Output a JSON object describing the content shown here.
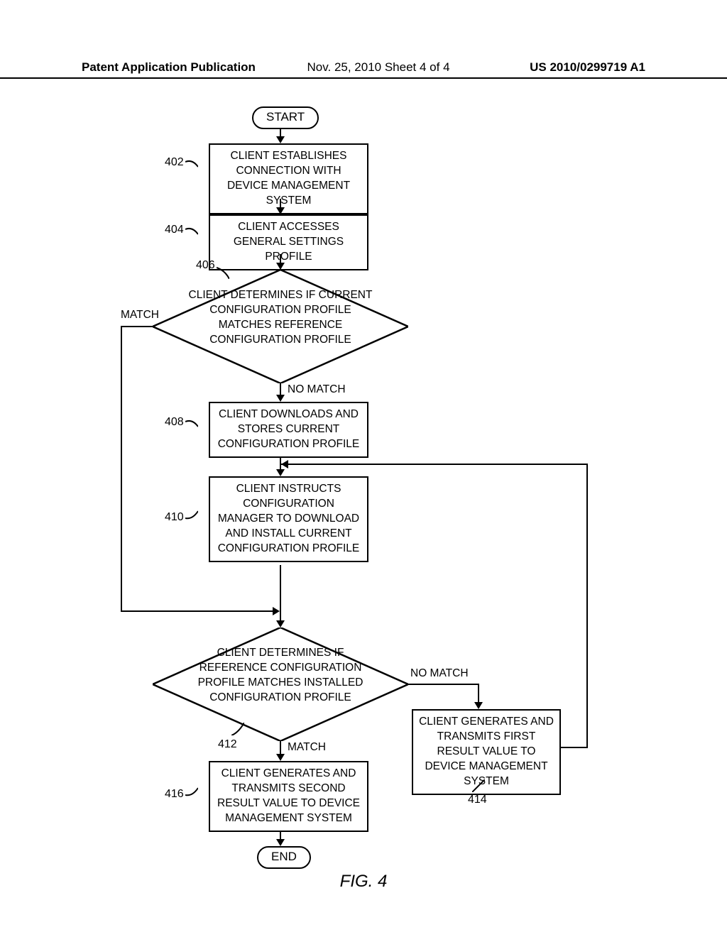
{
  "header": {
    "publication": "Patent Application Publication",
    "date_sheet": "Nov. 25, 2010  Sheet 4 of 4",
    "pubnum": "US 2010/0299719 A1"
  },
  "figure_caption": "FIG. 4",
  "nodes": {
    "start": "START",
    "end": "END",
    "402": "CLIENT ESTABLISHES CONNECTION WITH DEVICE MANAGEMENT SYSTEM",
    "404": "CLIENT ACCESSES GENERAL SETTINGS PROFILE",
    "406": "CLIENT DETERMINES IF CURRENT CONFIGURATION PROFILE MATCHES REFERENCE CONFIGURATION PROFILE",
    "408": "CLIENT DOWNLOADS AND STORES CURRENT CONFIGURATION PROFILE",
    "410": "CLIENT INSTRUCTS CONFIGURATION MANAGER TO DOWNLOAD AND INSTALL CURRENT CONFIGURATION PROFILE",
    "412": "CLIENT DETERMINES IF REFERENCE CONFIGURATION PROFILE MATCHES INSTALLED CONFIGURATION PROFILE",
    "414": "CLIENT GENERATES AND TRANSMITS FIRST RESULT VALUE TO DEVICE MANAGEMENT SYSTEM",
    "416": "CLIENT GENERATES AND TRANSMITS SECOND RESULT VALUE TO DEVICE MANAGEMENT SYSTEM"
  },
  "refs": {
    "402": "402",
    "404": "404",
    "406": "406",
    "408": "408",
    "410": "410",
    "412": "412",
    "414": "414",
    "416": "416"
  },
  "branches": {
    "match": "MATCH",
    "no_match": "NO MATCH"
  }
}
